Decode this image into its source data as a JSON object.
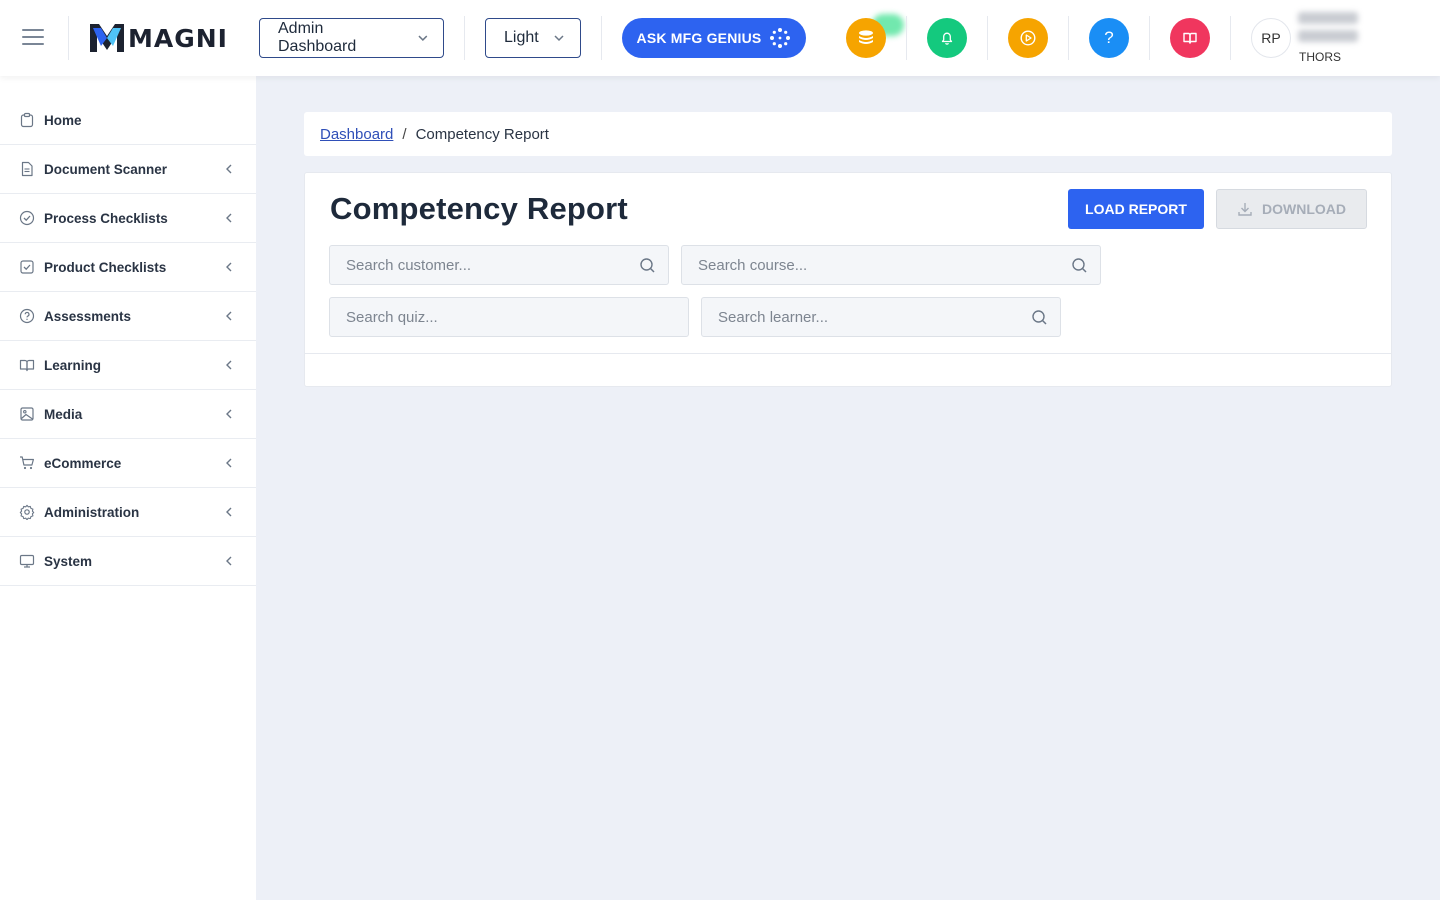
{
  "header": {
    "logo_text": "MAGNI",
    "dashboard_select": "Admin Dashboard",
    "theme_select": "Light",
    "ask_button": "ASK MFG GENIUS",
    "icons": [
      "coins-icon",
      "bell-icon",
      "play-icon",
      "help-icon",
      "book-icon"
    ],
    "icon_colors": [
      "#f6a400",
      "#14c97e",
      "#f6a400",
      "#1a8ef5",
      "#f0365e"
    ],
    "help_glyph": "?",
    "avatar_initials": "RP",
    "user_org": "THORS"
  },
  "sidebar": {
    "items": [
      {
        "label": "Home",
        "icon": "clipboard-icon",
        "expandable": false
      },
      {
        "label": "Document Scanner",
        "icon": "document-icon",
        "expandable": true
      },
      {
        "label": "Process Checklists",
        "icon": "check-circle-icon",
        "expandable": true
      },
      {
        "label": "Product Checklists",
        "icon": "check-square-icon",
        "expandable": true
      },
      {
        "label": "Assessments",
        "icon": "question-circle-icon",
        "expandable": true
      },
      {
        "label": "Learning",
        "icon": "book-open-icon",
        "expandable": true
      },
      {
        "label": "Media",
        "icon": "image-icon",
        "expandable": true
      },
      {
        "label": "eCommerce",
        "icon": "cart-icon",
        "expandable": true
      },
      {
        "label": "Administration",
        "icon": "gear-icon",
        "expandable": true
      },
      {
        "label": "System",
        "icon": "monitor-icon",
        "expandable": true
      }
    ]
  },
  "breadcrumb": {
    "link": "Dashboard",
    "separator": "/",
    "current": "Competency Report"
  },
  "report": {
    "title": "Competency Report",
    "load_button": "LOAD REPORT",
    "download_button": "DOWNLOAD",
    "search_customer_placeholder": "Search customer...",
    "search_course_placeholder": "Search course...",
    "search_quiz_placeholder": "Search quiz...",
    "search_learner_placeholder": "Search learner..."
  },
  "colors": {
    "primary": "#2d63f0",
    "background": "#edf0f7"
  }
}
